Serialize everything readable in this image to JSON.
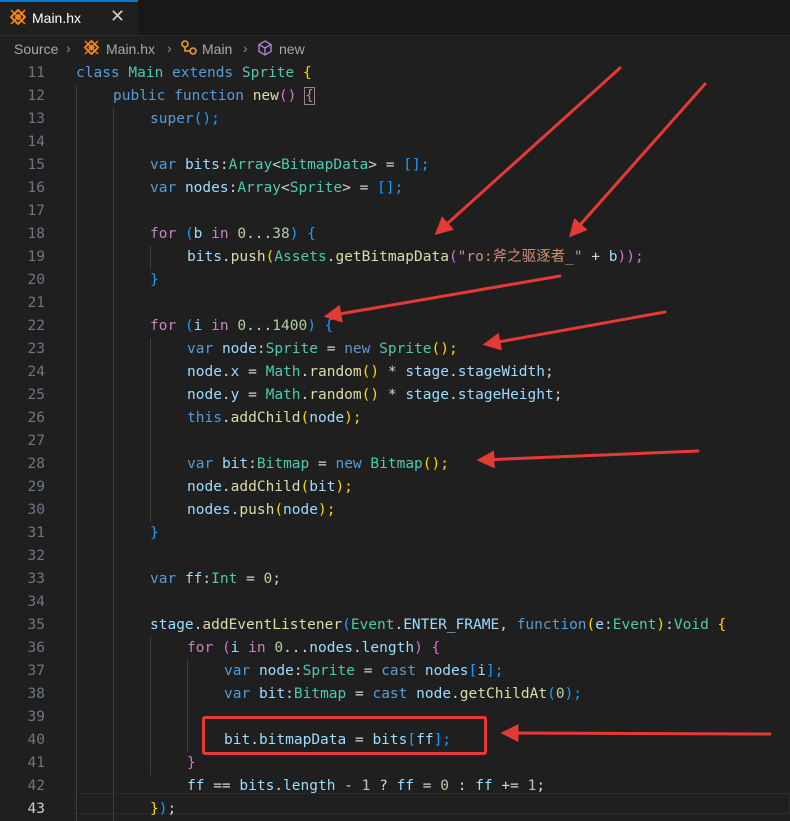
{
  "tab": {
    "label": "Main.hx",
    "close": "✕"
  },
  "breadcrumb": {
    "source": "Source",
    "file": "Main.hx",
    "class": "Main",
    "member": "new"
  },
  "lines": [
    "11",
    "12",
    "13",
    "14",
    "15",
    "16",
    "17",
    "18",
    "19",
    "20",
    "21",
    "22",
    "23",
    "24",
    "25",
    "26",
    "27",
    "28",
    "29",
    "30",
    "31",
    "32",
    "33",
    "34",
    "35",
    "36",
    "37",
    "38",
    "39",
    "40",
    "41",
    "42",
    "43"
  ],
  "code": {
    "l11": [
      "class",
      "Main",
      "extends",
      "Sprite",
      "{"
    ],
    "l12": [
      "public",
      "function",
      "new",
      "()",
      "{"
    ],
    "l13": [
      "super",
      "();"
    ],
    "l15": [
      "var",
      "bits",
      ":",
      "Array",
      "<",
      "BitmapData",
      ">",
      " = ",
      "[];"
    ],
    "l16": [
      "var",
      "nodes",
      ":",
      "Array",
      "<",
      "Sprite",
      ">",
      " = ",
      "[];"
    ],
    "l18": [
      "for",
      "(",
      "b",
      "in",
      "0",
      "...",
      "38",
      ")",
      "{"
    ],
    "l19": [
      "bits",
      ".",
      "push",
      "(",
      "Assets",
      ".",
      "getBitmapData",
      "(",
      "\"ro:斧之驱逐者_\"",
      " + ",
      "b",
      "));"
    ],
    "l20": [
      "}"
    ],
    "l22": [
      "for",
      "(",
      "i",
      "in",
      "0",
      "...",
      "1400",
      ")",
      "{"
    ],
    "l23": [
      "var",
      "node",
      ":",
      "Sprite",
      " = ",
      "new",
      "Sprite",
      "();"
    ],
    "l24": [
      "node",
      ".",
      "x",
      " = ",
      "Math",
      ".",
      "random",
      "()",
      " * ",
      "stage",
      ".",
      "stageWidth",
      ";"
    ],
    "l25": [
      "node",
      ".",
      "y",
      " = ",
      "Math",
      ".",
      "random",
      "()",
      " * ",
      "stage",
      ".",
      "stageHeight",
      ";"
    ],
    "l26": [
      "this",
      ".",
      "addChild",
      "(",
      "node",
      ");"
    ],
    "l28": [
      "var",
      "bit",
      ":",
      "Bitmap",
      " = ",
      "new",
      "Bitmap",
      "();"
    ],
    "l29": [
      "node",
      ".",
      "addChild",
      "(",
      "bit",
      ");"
    ],
    "l30": [
      "nodes",
      ".",
      "push",
      "(",
      "node",
      ");"
    ],
    "l31": [
      "}"
    ],
    "l33": [
      "var",
      "ff",
      ":",
      "Int",
      " = ",
      "0",
      ";"
    ],
    "l35": [
      "stage",
      ".",
      "addEventListener",
      "(",
      "Event",
      ".",
      "ENTER_FRAME",
      ", ",
      "function",
      "(",
      "e",
      ":",
      "Event",
      ")",
      ":",
      "Void",
      "{"
    ],
    "l36": [
      "for",
      "(",
      "i",
      "in",
      "0",
      "...",
      "nodes",
      ".",
      "length",
      ")",
      "{"
    ],
    "l37": [
      "var",
      "node",
      ":",
      "Sprite",
      " = ",
      "cast",
      "nodes",
      "[",
      "i",
      "];"
    ],
    "l38": [
      "var",
      "bit",
      ":",
      "Bitmap",
      " = ",
      "cast",
      "node",
      ".",
      "getChildAt",
      "(",
      "0",
      ");"
    ],
    "l40": [
      "bit",
      ".",
      "bitmapData",
      " = ",
      "bits",
      "[",
      "ff",
      "];"
    ],
    "l41": [
      "}"
    ],
    "l42": [
      "ff",
      " == ",
      "bits",
      ".",
      "length",
      " - ",
      "1",
      " ? ",
      "ff",
      " = ",
      "0",
      " : ",
      "ff",
      " += ",
      "1",
      ";"
    ],
    "l43": [
      "}",
      ")",
      ";"
    ]
  },
  "colors": {
    "keyword": "#569cd6",
    "control": "#c586c0",
    "type": "#4ec9b0",
    "variable": "#9cdcfe",
    "function": "#dcdcaa",
    "number": "#b5cea8",
    "string": "#ce9178",
    "annotation": "#e53935"
  },
  "icons": {
    "file": "haxe-icon",
    "class": "class-icon",
    "method": "cube-icon"
  }
}
